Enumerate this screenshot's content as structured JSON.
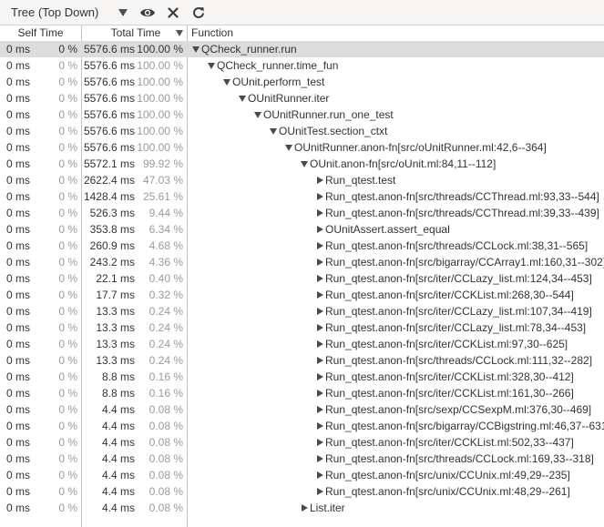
{
  "toolbar": {
    "view_label": "Tree (Top Down)",
    "view_icon": "chevron-down-icon",
    "buttons": [
      {
        "name": "toggle-visibility-button",
        "icon": "eye-icon"
      },
      {
        "name": "clear-button",
        "icon": "close-icon"
      },
      {
        "name": "reload-button",
        "icon": "refresh-icon"
      }
    ]
  },
  "columns": {
    "self": "Self Time",
    "total": "Total Time",
    "function": "Function"
  },
  "rows": [
    {
      "self_ms": "0 ms",
      "self_pct": "0 %",
      "total_ms": "5576.6 ms",
      "total_pct": "100.00 %",
      "name": "QCheck_runner.run",
      "depth": 0,
      "expander": "down",
      "selected": true
    },
    {
      "self_ms": "0 ms",
      "self_pct": "0 %",
      "total_ms": "5576.6 ms",
      "total_pct": "100.00 %",
      "name": "QCheck_runner.time_fun",
      "depth": 1,
      "expander": "down"
    },
    {
      "self_ms": "0 ms",
      "self_pct": "0 %",
      "total_ms": "5576.6 ms",
      "total_pct": "100.00 %",
      "name": "OUnit.perform_test",
      "depth": 2,
      "expander": "down"
    },
    {
      "self_ms": "0 ms",
      "self_pct": "0 %",
      "total_ms": "5576.6 ms",
      "total_pct": "100.00 %",
      "name": "OUnitRunner.iter",
      "depth": 3,
      "expander": "down"
    },
    {
      "self_ms": "0 ms",
      "self_pct": "0 %",
      "total_ms": "5576.6 ms",
      "total_pct": "100.00 %",
      "name": "OUnitRunner.run_one_test",
      "depth": 4,
      "expander": "down"
    },
    {
      "self_ms": "0 ms",
      "self_pct": "0 %",
      "total_ms": "5576.6 ms",
      "total_pct": "100.00 %",
      "name": "OUnitTest.section_ctxt",
      "depth": 5,
      "expander": "down"
    },
    {
      "self_ms": "0 ms",
      "self_pct": "0 %",
      "total_ms": "5576.6 ms",
      "total_pct": "100.00 %",
      "name": "OUnitRunner.anon-fn[src/oUnitRunner.ml:42,6--364]",
      "depth": 6,
      "expander": "down"
    },
    {
      "self_ms": "0 ms",
      "self_pct": "0 %",
      "total_ms": "5572.1 ms",
      "total_pct": "99.92 %",
      "name": "OUnit.anon-fn[src/oUnit.ml:84,11--112]",
      "depth": 7,
      "expander": "down"
    },
    {
      "self_ms": "0 ms",
      "self_pct": "0 %",
      "total_ms": "2622.4 ms",
      "total_pct": "47.03 %",
      "name": "Run_qtest.test",
      "depth": 8,
      "expander": "right"
    },
    {
      "self_ms": "0 ms",
      "self_pct": "0 %",
      "total_ms": "1428.4 ms",
      "total_pct": "25.61 %",
      "name": "Run_qtest.anon-fn[src/threads/CCThread.ml:93,33--544]",
      "depth": 8,
      "expander": "right"
    },
    {
      "self_ms": "0 ms",
      "self_pct": "0 %",
      "total_ms": "526.3 ms",
      "total_pct": "9.44 %",
      "name": "Run_qtest.anon-fn[src/threads/CCThread.ml:39,33--439]",
      "depth": 8,
      "expander": "right"
    },
    {
      "self_ms": "0 ms",
      "self_pct": "0 %",
      "total_ms": "353.8 ms",
      "total_pct": "6.34 %",
      "name": "OUnitAssert.assert_equal",
      "depth": 8,
      "expander": "right"
    },
    {
      "self_ms": "0 ms",
      "self_pct": "0 %",
      "total_ms": "260.9 ms",
      "total_pct": "4.68 %",
      "name": "Run_qtest.anon-fn[src/threads/CCLock.ml:38,31--565]",
      "depth": 8,
      "expander": "right"
    },
    {
      "self_ms": "0 ms",
      "self_pct": "0 %",
      "total_ms": "243.2 ms",
      "total_pct": "4.36 %",
      "name": "Run_qtest.anon-fn[src/bigarray/CCArray1.ml:160,31--302]",
      "depth": 8,
      "expander": "right"
    },
    {
      "self_ms": "0 ms",
      "self_pct": "0 %",
      "total_ms": "22.1 ms",
      "total_pct": "0.40 %",
      "name": "Run_qtest.anon-fn[src/iter/CCLazy_list.ml:124,34--453]",
      "depth": 8,
      "expander": "right"
    },
    {
      "self_ms": "0 ms",
      "self_pct": "0 %",
      "total_ms": "17.7 ms",
      "total_pct": "0.32 %",
      "name": "Run_qtest.anon-fn[src/iter/CCKList.ml:268,30--544]",
      "depth": 8,
      "expander": "right"
    },
    {
      "self_ms": "0 ms",
      "self_pct": "0 %",
      "total_ms": "13.3 ms",
      "total_pct": "0.24 %",
      "name": "Run_qtest.anon-fn[src/iter/CCLazy_list.ml:107,34--419]",
      "depth": 8,
      "expander": "right"
    },
    {
      "self_ms": "0 ms",
      "self_pct": "0 %",
      "total_ms": "13.3 ms",
      "total_pct": "0.24 %",
      "name": "Run_qtest.anon-fn[src/iter/CCLazy_list.ml:78,34--453]",
      "depth": 8,
      "expander": "right"
    },
    {
      "self_ms": "0 ms",
      "self_pct": "0 %",
      "total_ms": "13.3 ms",
      "total_pct": "0.24 %",
      "name": "Run_qtest.anon-fn[src/iter/CCKList.ml:97,30--625]",
      "depth": 8,
      "expander": "right"
    },
    {
      "self_ms": "0 ms",
      "self_pct": "0 %",
      "total_ms": "13.3 ms",
      "total_pct": "0.24 %",
      "name": "Run_qtest.anon-fn[src/threads/CCLock.ml:111,32--282]",
      "depth": 8,
      "expander": "right"
    },
    {
      "self_ms": "0 ms",
      "self_pct": "0 %",
      "total_ms": "8.8 ms",
      "total_pct": "0.16 %",
      "name": "Run_qtest.anon-fn[src/iter/CCKList.ml:328,30--412]",
      "depth": 8,
      "expander": "right"
    },
    {
      "self_ms": "0 ms",
      "self_pct": "0 %",
      "total_ms": "8.8 ms",
      "total_pct": "0.16 %",
      "name": "Run_qtest.anon-fn[src/iter/CCKList.ml:161,30--266]",
      "depth": 8,
      "expander": "right"
    },
    {
      "self_ms": "0 ms",
      "self_pct": "0 %",
      "total_ms": "4.4 ms",
      "total_pct": "0.08 %",
      "name": "Run_qtest.anon-fn[src/sexp/CCSexpM.ml:376,30--469]",
      "depth": 8,
      "expander": "right"
    },
    {
      "self_ms": "0 ms",
      "self_pct": "0 %",
      "total_ms": "4.4 ms",
      "total_pct": "0.08 %",
      "name": "Run_qtest.anon-fn[src/bigarray/CCBigstring.ml:46,37--631]",
      "depth": 8,
      "expander": "right"
    },
    {
      "self_ms": "0 ms",
      "self_pct": "0 %",
      "total_ms": "4.4 ms",
      "total_pct": "0.08 %",
      "name": "Run_qtest.anon-fn[src/iter/CCKList.ml:502,33--437]",
      "depth": 8,
      "expander": "right"
    },
    {
      "self_ms": "0 ms",
      "self_pct": "0 %",
      "total_ms": "4.4 ms",
      "total_pct": "0.08 %",
      "name": "Run_qtest.anon-fn[src/threads/CCLock.ml:169,33--318]",
      "depth": 8,
      "expander": "right"
    },
    {
      "self_ms": "0 ms",
      "self_pct": "0 %",
      "total_ms": "4.4 ms",
      "total_pct": "0.08 %",
      "name": "Run_qtest.anon-fn[src/unix/CCUnix.ml:49,29--235]",
      "depth": 8,
      "expander": "right"
    },
    {
      "self_ms": "0 ms",
      "self_pct": "0 %",
      "total_ms": "4.4 ms",
      "total_pct": "0.08 %",
      "name": "Run_qtest.anon-fn[src/unix/CCUnix.ml:48,29--261]",
      "depth": 8,
      "expander": "right"
    },
    {
      "self_ms": "0 ms",
      "self_pct": "0 %",
      "total_ms": "4.4 ms",
      "total_pct": "0.08 %",
      "name": "List.iter",
      "depth": 7,
      "expander": "right"
    }
  ]
}
